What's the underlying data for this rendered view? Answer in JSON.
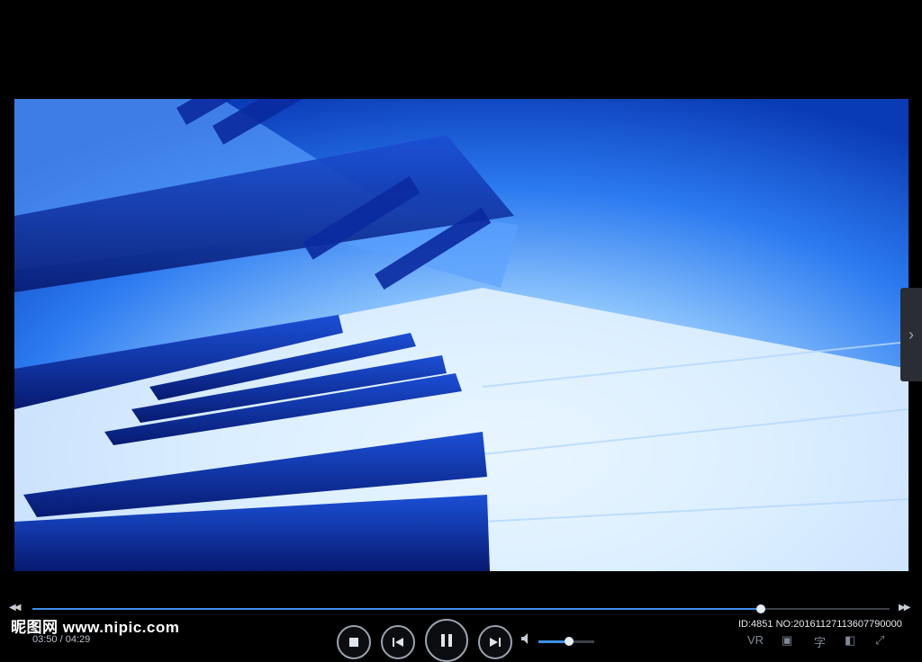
{
  "player": {
    "seek_back_icon": "double-left-arrow",
    "seek_forward_icon": "double-right-arrow",
    "progress_fraction": 0.85,
    "volume_fraction": 0.55,
    "current_time": "03:50",
    "total_time": "04:29",
    "time_display": "03:50 / 04:29",
    "side_panel_icon": "chevron-right"
  },
  "watermark": {
    "site_text": "昵图网 www.nipic.com",
    "id_text": "ID:4851 NO:20161127113607790000"
  },
  "right_controls": {
    "vr_label": "VR",
    "subtitle_label": "字"
  },
  "colors": {
    "accent": "#3d8fe6",
    "video_blue": "#1a5fe0",
    "background": "#000000"
  }
}
